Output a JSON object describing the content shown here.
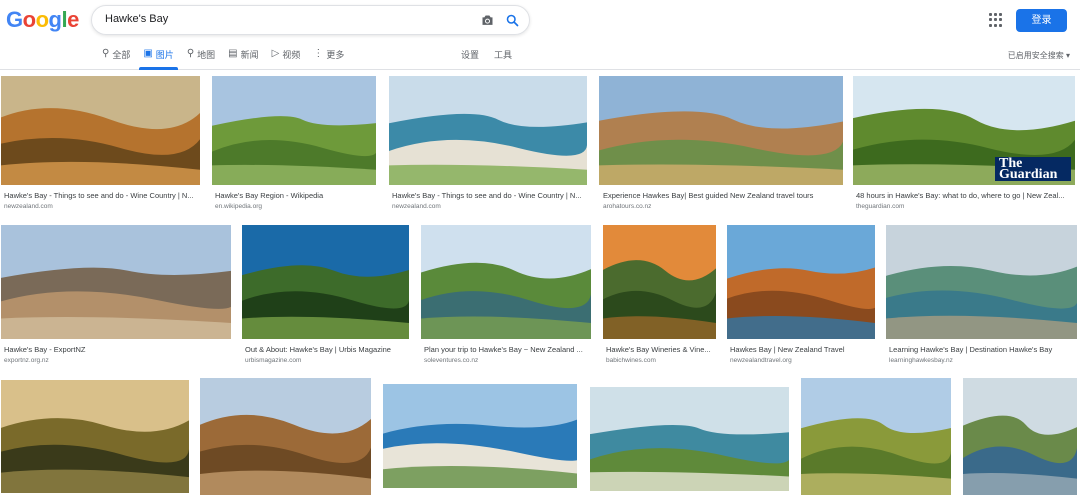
{
  "search": {
    "query": "Hawke's Bay"
  },
  "logo": {
    "letters": [
      "G",
      "o",
      "o",
      "g",
      "l",
      "e"
    ],
    "colors": [
      "#4285F4",
      "#EA4335",
      "#FBBC05",
      "#4285F4",
      "#34A853",
      "#EA4335"
    ]
  },
  "header": {
    "signin_label": "登录"
  },
  "tabs": [
    {
      "label": "全部",
      "icon": "search-icon"
    },
    {
      "label": "图片",
      "icon": "image-icon",
      "active": true
    },
    {
      "label": "地图",
      "icon": "map-pin-icon"
    },
    {
      "label": "新闻",
      "icon": "news-icon"
    },
    {
      "label": "视频",
      "icon": "video-icon"
    },
    {
      "label": "更多",
      "icon": "more-icon"
    }
  ],
  "tools": {
    "settings_label": "设置",
    "tools_label": "工具",
    "safesearch_label": "已启用安全搜索 ▾"
  },
  "accent_color": "#1a73e8",
  "results": [
    {
      "title": "Hawke's Bay - Things to see and do - Wine Country | N...",
      "source": "newzealand.com"
    },
    {
      "title": "Hawke's Bay Region - Wikipedia",
      "source": "en.wikipedia.org"
    },
    {
      "title": "Hawke's Bay - Things to see and do - Wine Country | N...",
      "source": "newzealand.com"
    },
    {
      "title": "Experience Hawkes Bay| Best guided New Zealand travel tours",
      "source": "arohatours.co.nz"
    },
    {
      "title": "48 hours in Hawke's Bay: what to do, where to go | New Zeal...",
      "source": "theguardian.com"
    },
    {
      "title": "Hawke's Bay - ExportNZ",
      "source": "exportnz.org.nz"
    },
    {
      "title": "Out & About: Hawke's Bay | Urbis Magazine",
      "source": "urbismagazine.com"
    },
    {
      "title": "Plan your trip to Hawke's Bay ~ New Zealand ...",
      "source": "soleventures.co.nz"
    },
    {
      "title": "Hawke's Bay Wineries & Vine...",
      "source": "babichwines.com"
    },
    {
      "title": "Hawkes Bay | New Zealand Travel",
      "source": "newzealandtravel.org"
    },
    {
      "title": "Learning Hawke's Bay | Destination Hawke's Bay",
      "source": "learninghawkesbay.nz"
    },
    {
      "title": "",
      "source": ""
    },
    {
      "title": "",
      "source": ""
    },
    {
      "title": "",
      "source": ""
    },
    {
      "title": "",
      "source": ""
    },
    {
      "title": "",
      "source": ""
    },
    {
      "title": "",
      "source": ""
    }
  ],
  "guardian_badge": "The Guardian"
}
